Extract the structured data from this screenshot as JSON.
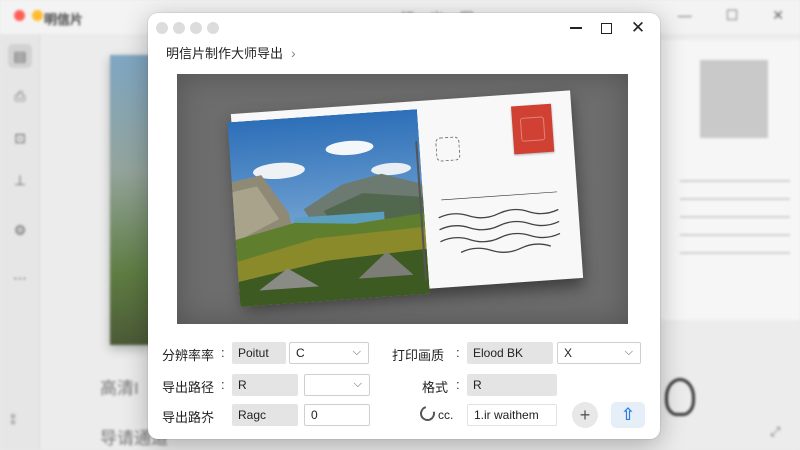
{
  "background": {
    "app_title": "明信片",
    "menu_text": "打   出   图",
    "text_1": "高清I",
    "text_2": "导请通道"
  },
  "dialog": {
    "breadcrumb": "明信片制作大师导出",
    "breadcrumb_chevron": "›",
    "close_symbol": "✕"
  },
  "form": {
    "resolution": {
      "label": "分辨率率",
      "value": "Poitut",
      "select": "C"
    },
    "output_path": {
      "label": "导出路径",
      "value": "R",
      "select": ""
    },
    "export_path": {
      "label": "导出路岕",
      "value": "Ragc",
      "input": "0"
    },
    "print_mode": {
      "label": "打印画质",
      "value": "Elood BK",
      "select": "X"
    },
    "format": {
      "label": "格式",
      "value": "R"
    },
    "spinner_text": "cc.",
    "status_text": "1.ir waithem",
    "colon": ":",
    "add_symbol": "+",
    "upload_symbol": "⇧"
  },
  "colors": {
    "accent": "#2f7de1",
    "stamp": "#d04134",
    "close_red": "#ff5f57",
    "min_yellow": "#febc2e",
    "max_green": "#28c840"
  }
}
